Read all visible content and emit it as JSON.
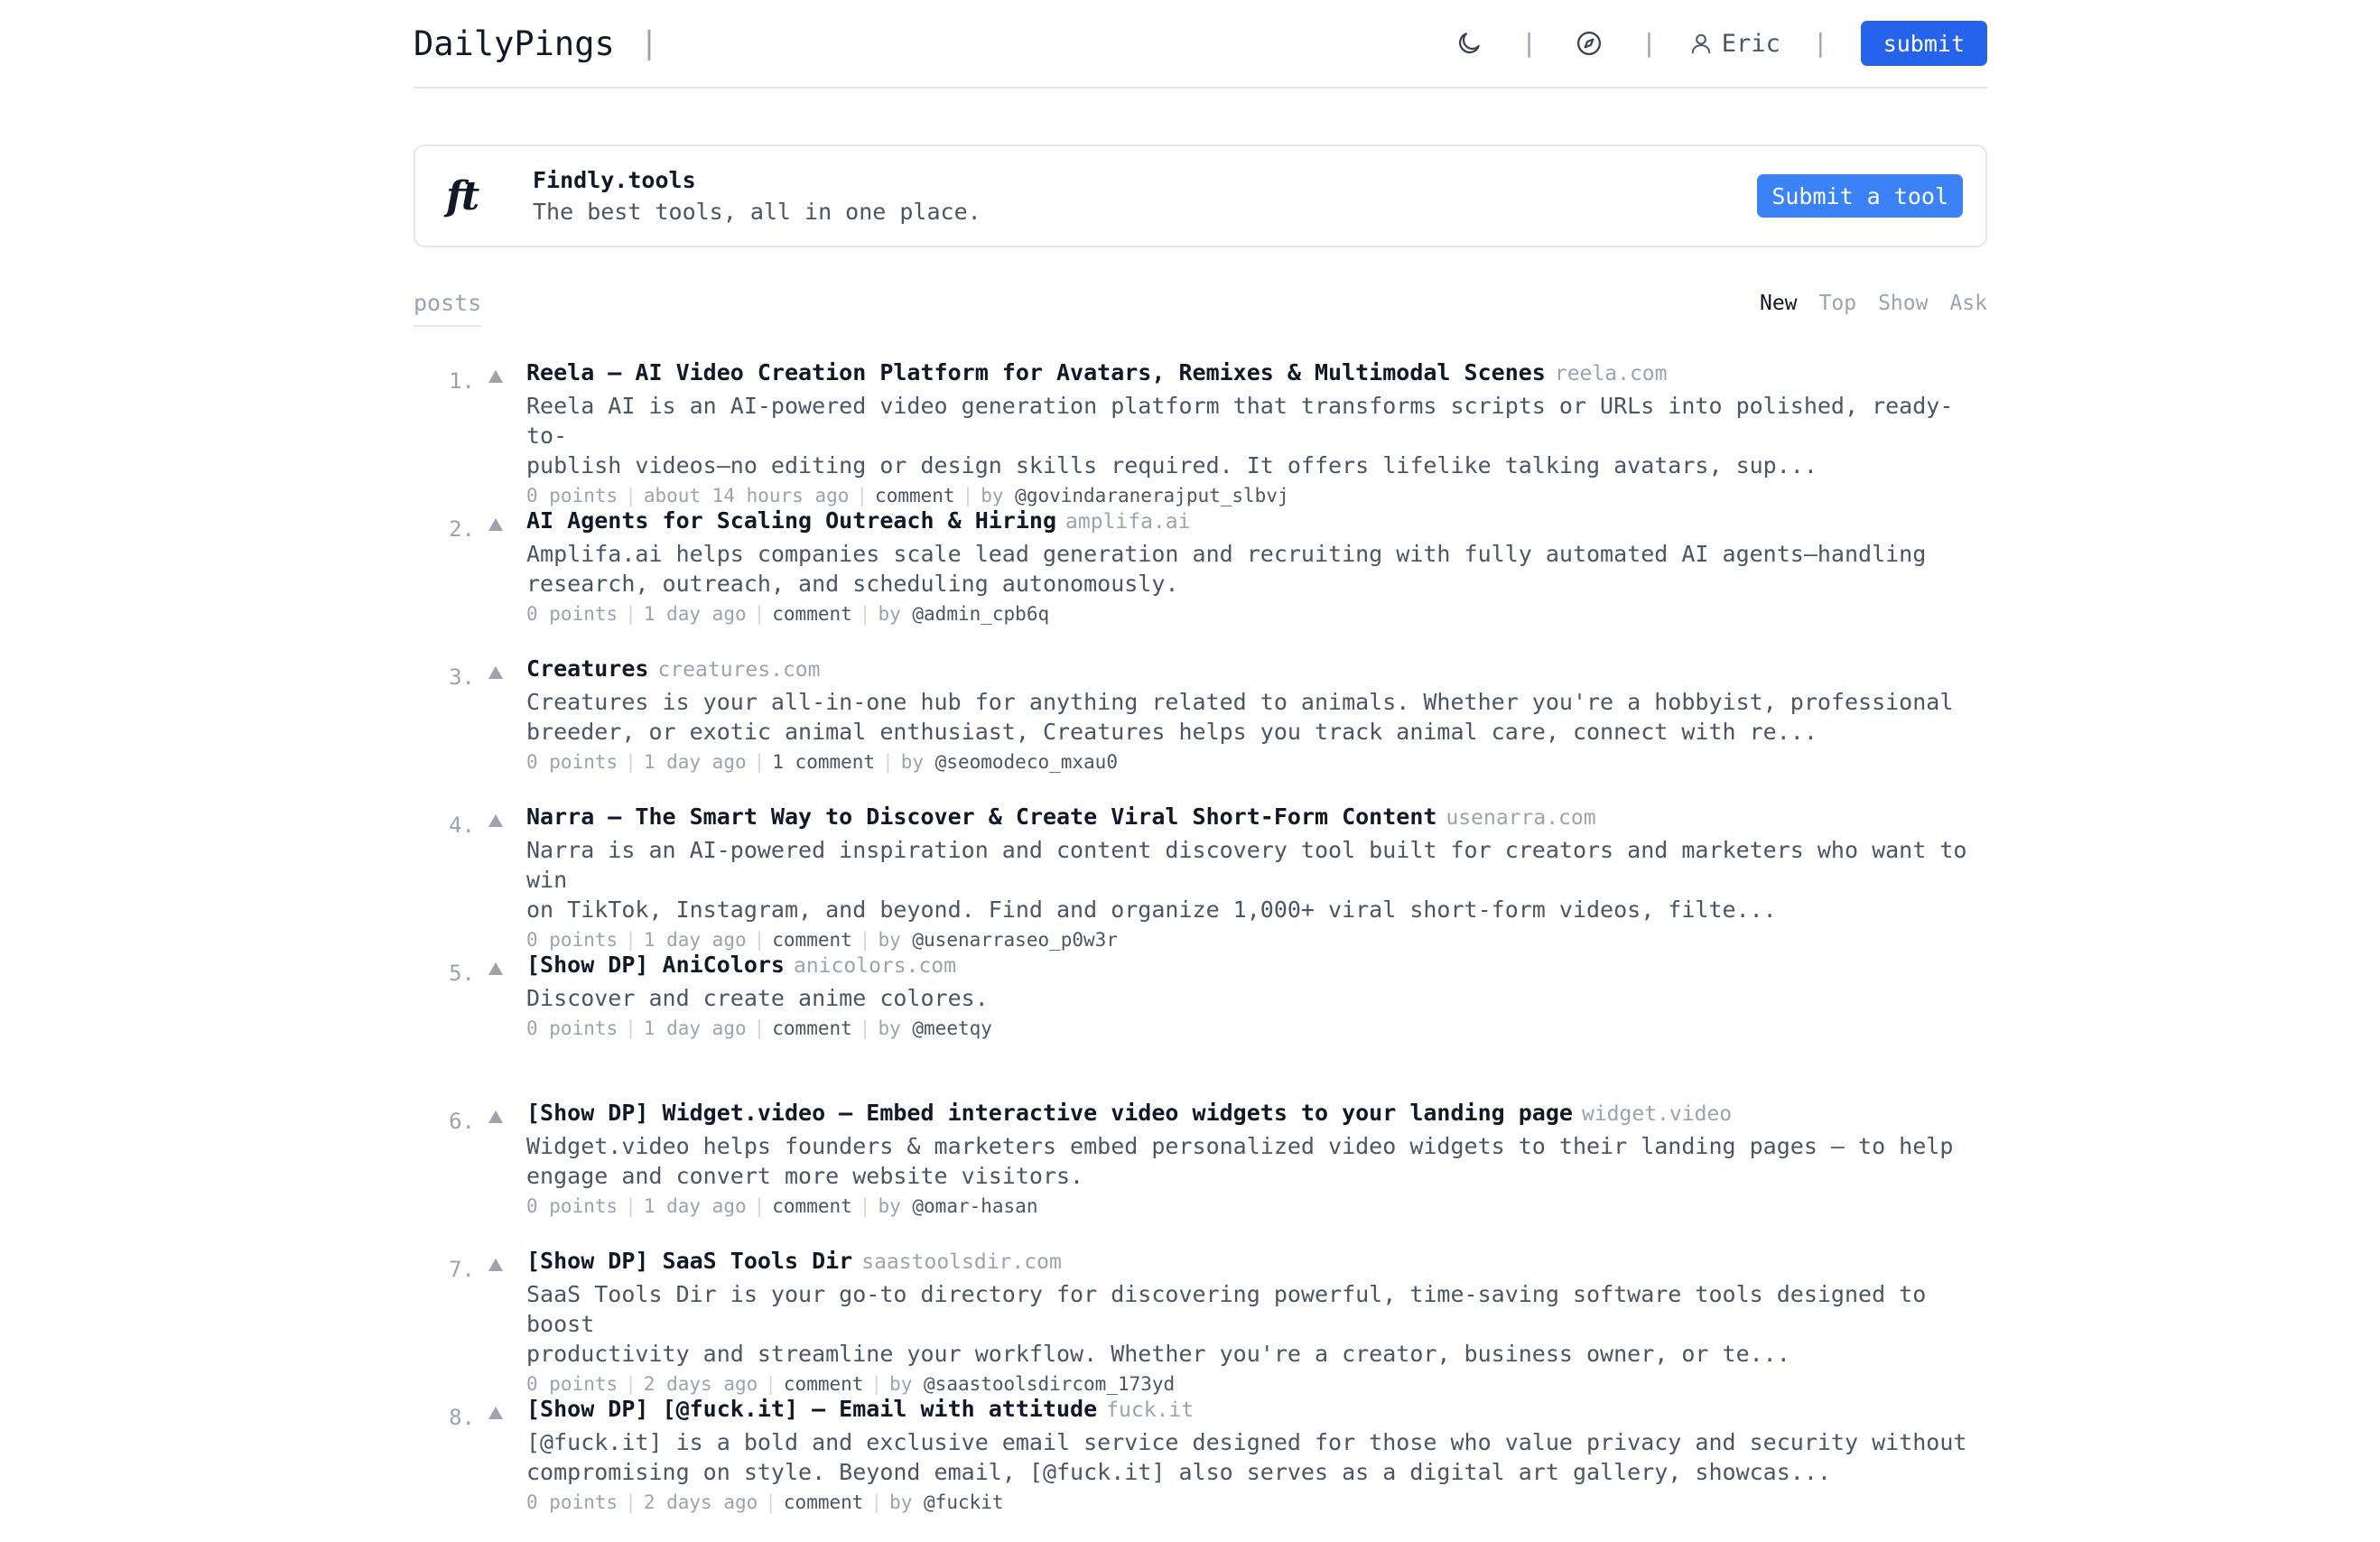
{
  "header": {
    "brand": "DailyPings",
    "user_name": "Eric",
    "submit_label": "submit"
  },
  "sponsor": {
    "logo_text": "ft",
    "title": "Findly.tools",
    "subtitle": "The best tools, all in one place.",
    "button_label": "Submit a tool"
  },
  "tabs": {
    "posts_label": "posts",
    "filters": [
      "New",
      "Top",
      "Show",
      "Ask"
    ],
    "active": "New"
  },
  "items": [
    {
      "rank": "1.",
      "title": "Reela – AI Video Creation Platform for Avatars, Remixes & Multimodal Scenes",
      "domain": "reela.com",
      "desc1": "Reela AI is an AI-powered video generation platform that transforms scripts or URLs into polished, ready-to-",
      "desc2": "publish videos—no editing or design skills required. It offers lifelike talking avatars, sup...",
      "points": "0 points",
      "time": "about 14 hours ago",
      "comments": "comment",
      "by": "by",
      "author": "@govindaranerajput_slbvj"
    },
    {
      "rank": "2.",
      "title": "AI Agents for Scaling Outreach & Hiring",
      "domain": "amplifa.ai",
      "desc1": "Amplifa.ai helps companies scale lead generation and recruiting with fully automated AI agents—handling",
      "desc2": "research, outreach, and scheduling autonomously.",
      "points": "0 points",
      "time": "1 day ago",
      "comments": "comment",
      "by": "by",
      "author": "@admin_cpb6q"
    },
    {
      "rank": "3.",
      "title": "Creatures",
      "domain": "creatures.com",
      "desc1": "Creatures is your all-in-one hub for anything related to animals. Whether you're a hobbyist, professional",
      "desc2": "breeder, or exotic animal enthusiast, Creatures helps you track animal care, connect with re...",
      "points": "0 points",
      "time": "1 day ago",
      "comments": "1 comment",
      "by": "by",
      "author": "@seomodeco_mxau0"
    },
    {
      "rank": "4.",
      "title": "Narra – The Smart Way to Discover & Create Viral Short-Form Content",
      "domain": "usenarra.com",
      "desc1": "Narra is an AI-powered inspiration and content discovery tool built for creators and marketers who want to win",
      "desc2": "on TikTok, Instagram, and beyond. Find and organize 1,000+ viral short-form videos, filte...",
      "points": "0 points",
      "time": "1 day ago",
      "comments": "comment",
      "by": "by",
      "author": "@usenarraseo_p0w3r"
    },
    {
      "rank": "5.",
      "title": "[Show DP] AniColors",
      "domain": "anicolors.com",
      "desc1": "Discover and create anime colores.",
      "desc2": "",
      "points": "0 points",
      "time": "1 day ago",
      "comments": "comment",
      "by": "by",
      "author": "@meetqy"
    },
    {
      "rank": "6.",
      "title": "[Show DP] Widget.video – Embed interactive video widgets to your landing page",
      "domain": "widget.video",
      "desc1": "Widget.video helps founders & marketers embed personalized video widgets to their landing pages – to help",
      "desc2": "engage and convert more website visitors.",
      "points": "0 points",
      "time": "1 day ago",
      "comments": "comment",
      "by": "by",
      "author": "@omar-hasan"
    },
    {
      "rank": "7.",
      "title": "[Show DP] SaaS Tools Dir",
      "domain": "saastoolsdir.com",
      "desc1": "SaaS Tools Dir is your go-to directory for discovering powerful, time-saving software tools designed to boost",
      "desc2": "productivity and streamline your workflow. Whether you're a creator, business owner, or te...",
      "points": "0 points",
      "time": "2 days ago",
      "comments": "comment",
      "by": "by",
      "author": "@saastoolsdircom_173yd"
    },
    {
      "rank": "8.",
      "title": "[Show DP] [@fuck.it] – Email with attitude",
      "domain": "fuck.it",
      "desc1": "[@fuck.it] is a bold and exclusive email service designed for those who value privacy and security without",
      "desc2": "compromising on style. Beyond email, [@fuck.it] also serves as a digital art gallery, showcas...",
      "points": "0 points",
      "time": "2 days ago",
      "comments": "comment",
      "by": "by",
      "author": "@fuckit"
    }
  ]
}
